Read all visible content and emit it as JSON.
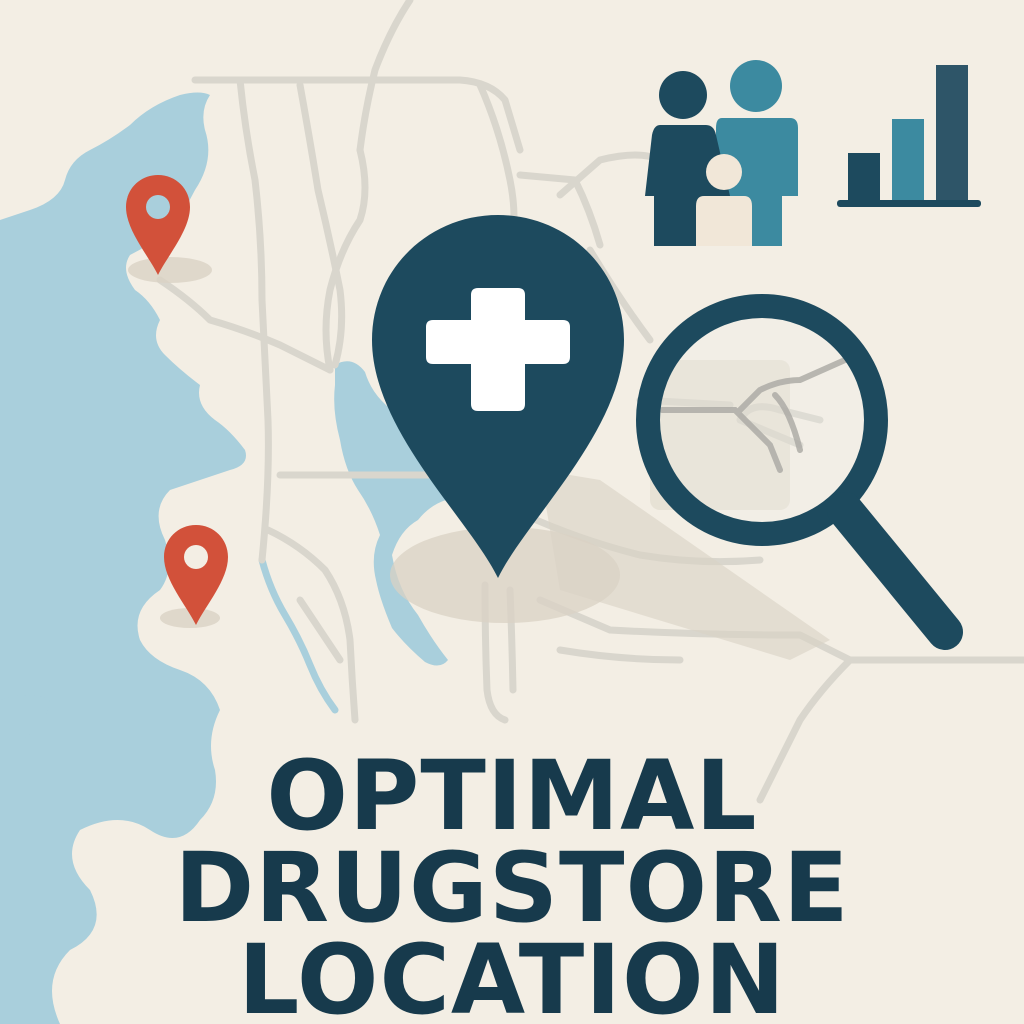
{
  "title": {
    "line1": "OPTIMAL",
    "line2": "DRUGSTORE",
    "line3": "LOCATION"
  },
  "colors": {
    "background": "#f3eee4",
    "water": "#a9cfdc",
    "road": "#d9d6cd",
    "primary_navy": "#1d4a5e",
    "teal": "#3c8aa0",
    "marker_red": "#d2513a",
    "figure_light": "#f1e7d8",
    "shadow": "#d9d2c4"
  },
  "icons": {
    "main_marker": "pharmacy-location-pin-icon",
    "competitor_markers": [
      "location-pin-icon",
      "location-pin-icon"
    ],
    "demographics": "family-icon",
    "statistics": "bar-chart-icon",
    "analysis": "magnifying-glass-icon"
  },
  "bar_chart_levels": [
    0.35,
    0.6,
    1.0
  ]
}
